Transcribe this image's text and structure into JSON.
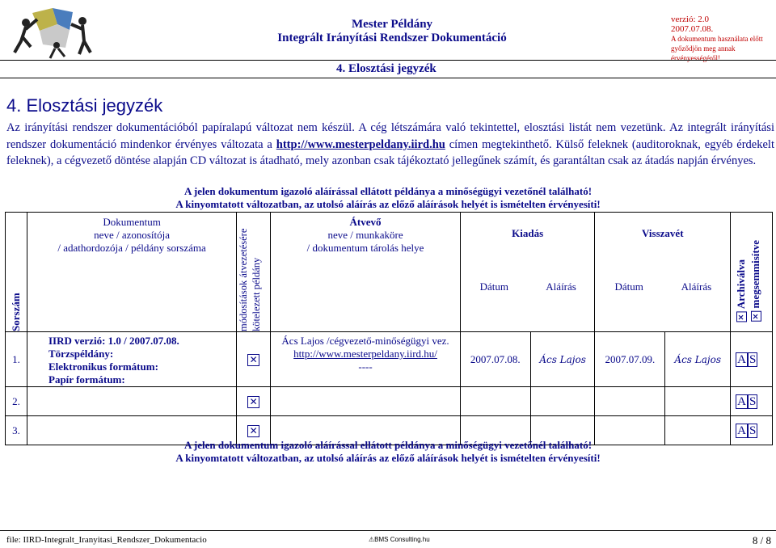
{
  "header": {
    "title_line1": "Mester Példány",
    "title_line2": "Integrált Irányítási Rendszer Dokumentáció",
    "version": "verzió: 2.0",
    "date": "2007.07.08.",
    "notice_line1": "A dokumentum használata előtt",
    "notice_line2": "győződjön meg annak érvényességéről!",
    "section": "4. Elosztási jegyzék"
  },
  "heading": "4. Elosztási jegyzék",
  "intro": {
    "text1": "Az irányítási rendszer dokumentációból papíralapú változat nem készül. A cég létszámára való tekintettel, elosztási listát nem vezetünk. Az integrált irányítási rendszer dokumentáció mindenkor érvényes változata a ",
    "link": "http://www.mesterpeldany.iird.hu",
    "text2": " címen megtekinthető. Külső feleknek (auditoroknak, egyéb érdekelt feleknek), a cégvezető döntése alapján CD változat is átadható, mely azonban csak tájékoztató jellegűnek számít, és garantáltan csak az átadás napján érvényes."
  },
  "warning": {
    "line1": "A jelen dokumentum igazoló aláírással ellátott példánya a minőségügyi vezetőnél található!",
    "line2": "A kinyomtatott változatban, az utolsó aláírás az előző aláírások helyét is ismételten érvényesíti!"
  },
  "table": {
    "col_sorszam": "Sorszám",
    "col_doc_title": "Dokumentum",
    "col_doc_sub1": "neve / azonosítója",
    "col_doc_sub2": "/ adathordozója / példány sorszáma",
    "col_mod_line1": "módosítások átvezetésére",
    "col_mod_line2": "kötelezett példány",
    "col_atvevo_title": "Átvevő",
    "col_atvevo_sub1": "neve / munkaköre",
    "col_atvevo_sub2": "/ dokumentum tárolás helye",
    "col_kiadas": "Kiadás",
    "col_visszavet": "Visszavét",
    "col_datum1": "Dátum",
    "col_alairas1": "Aláírás",
    "col_datum2": "Dátum",
    "col_alairas2": "Aláírás",
    "col_archivalva": "Archiválva",
    "col_megsemmisitve": "megsemmisítve",
    "rows": [
      {
        "num": "1.",
        "doc_line1": "IIRD verzió: 1.0 / 2007.07.08.  Törzspéldány:",
        "doc_line2": "Elektronikus formátum:",
        "doc_line3": "Papír formátum:",
        "atvevo_line1": "Ács Lajos /cégvezető-minőségügyi vez.",
        "atvevo_line2": "http://www.mesterpeldany.iird.hu/",
        "atvevo_line3": "----",
        "kiadas_datum": "2007.07.08.",
        "kiadas_alairas": "Ács Lajos",
        "visszavet_datum": "2007.07.09.",
        "visszavet_alairas": "Ács Lajos",
        "a": "A",
        "s": "S"
      },
      {
        "num": "2.",
        "a": "A",
        "s": "S"
      },
      {
        "num": "3.",
        "a": "A",
        "s": "S"
      }
    ]
  },
  "footer": {
    "file": "file: IIRD-Integralt_Iranyitasi_Rendszer_Dokumentacio",
    "brand": "BMS Consulting.hu",
    "page": "8 / 8"
  }
}
